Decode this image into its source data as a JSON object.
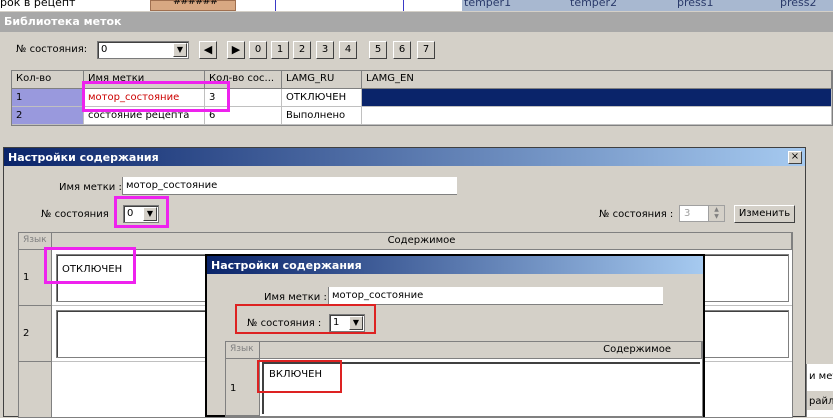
{
  "top_strip": {
    "fragment_left": "рок в рецепт",
    "button_text": "######",
    "columns": [
      "temper1",
      "temper2",
      "press1",
      "press2"
    ]
  },
  "library": {
    "title": "Библиотека меток",
    "state_label": "№ состояния:",
    "state_value": "0",
    "buttons": [
      "0",
      "1",
      "2",
      "3",
      "4",
      "5",
      "6",
      "7"
    ],
    "prev_icon": "triangle-left",
    "next_icon": "triangle-right",
    "headers": [
      "Кол-во",
      "Имя метки",
      "Кол-во сос...",
      "LAMG_RU",
      "LAMG_EN"
    ],
    "rows": [
      {
        "num": "1",
        "name": "мотор_состояние",
        "count": "3",
        "ru": "ОТКЛЮЧЕН",
        "en": ""
      },
      {
        "num": "2",
        "name": "состояние рецепта",
        "count": "6",
        "ru": "Выполнено",
        "en": ""
      }
    ]
  },
  "dialog1": {
    "title": "Настройки содержания",
    "close": "×",
    "name_label": "Имя метки :",
    "name_value": "мотор_состояние",
    "state_label": "№ состояния",
    "state_value": "0",
    "right_state_label": "№ состояния :",
    "right_state_value": "3",
    "change_button": "Изменить",
    "col_lang": "Язык",
    "col_content": "Содержимое",
    "rows": [
      {
        "num": "1",
        "content": "ОТКЛЮЧЕН"
      },
      {
        "num": "2",
        "content": ""
      }
    ]
  },
  "dialog2": {
    "title": "Настройки содержания",
    "name_label": "Имя метки :",
    "name_value": "мотор_состояние",
    "state_label": "№ состояния :",
    "state_value": "1",
    "col_lang": "Язык",
    "col_content": "Содержимое",
    "rows": [
      {
        "num": "1",
        "content": "ВКЛЮЧЕН"
      }
    ]
  },
  "right_fragments": {
    "line1": "и мето",
    "line2": "райла"
  },
  "colors": {
    "highlight_magenta": "#ee22ee",
    "highlight_red": "#dd2222",
    "selection": "#0a246a"
  }
}
